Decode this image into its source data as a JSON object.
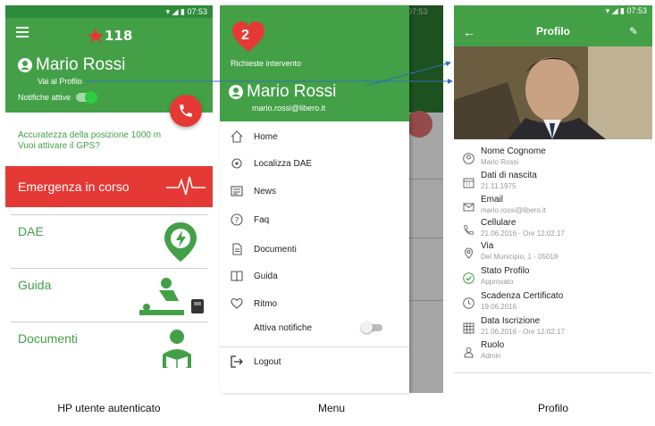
{
  "status_time": "07:53",
  "colors": {
    "primary": "#43a047",
    "emergency": "#e53935",
    "divider": "#cccccc"
  },
  "home": {
    "user_name": "Mario Rossi",
    "profile_link": "Vai al Profilo",
    "notifications_label": "Notifiche attive",
    "gps_line1": "Accuratezza della posizione 1000 m",
    "gps_line2": "Vuoi attivare il GPS?",
    "emergency_label": "Emergenza in corso",
    "tiles": [
      {
        "label": "DAE",
        "icon": "dae-location-icon"
      },
      {
        "label": "Guida",
        "icon": "cpr-guide-icon"
      },
      {
        "label": "Documenti",
        "icon": "reading-person-icon"
      }
    ]
  },
  "menu": {
    "badge_count": "2",
    "requests_label": "Richieste intervento",
    "user_name": "Mario Rossi",
    "email": "mario.rossi@libero.it",
    "items": [
      {
        "label": "Home",
        "icon": "home-icon"
      },
      {
        "label": "Localizza DAE",
        "icon": "locate-icon"
      },
      {
        "label": "News",
        "icon": "news-icon"
      },
      {
        "label": "Faq",
        "icon": "help-icon"
      },
      {
        "label": "Documenti",
        "icon": "document-icon"
      },
      {
        "label": "Guida",
        "icon": "book-icon"
      },
      {
        "label": "Ritmo",
        "icon": "heart-outline-icon"
      }
    ],
    "notifications_label": "Attiva notifiche",
    "logout_label": "Logout"
  },
  "profile": {
    "title": "Profilo",
    "fields": [
      {
        "label": "Nome Cognome",
        "value": "Mario Rossi",
        "icon": "user-circle-icon"
      },
      {
        "label": "Dati di nascita",
        "value": "21.11.1975",
        "icon": "calendar-icon"
      },
      {
        "label": "Email",
        "value": "mario.rossi@libero.it",
        "icon": "mail-icon"
      },
      {
        "label": "Cellulare",
        "value": "21.06.2016 - Ore 12:02:17",
        "icon": "phone-icon"
      },
      {
        "label": "Via",
        "value": "Del Municipio, 1 - 05018",
        "icon": "location-icon"
      },
      {
        "label": "Stato Profilo",
        "value": "Approvato",
        "icon": "check-circle-icon"
      },
      {
        "label": "Scadenza Certificato",
        "value": "19.06.2016",
        "icon": "clock-icon"
      },
      {
        "label": "Data Iscrizione",
        "value": "21.06.2016 - Ore 12:02:17",
        "icon": "calendar-grid-icon"
      },
      {
        "label": "Ruolo",
        "value": "Admin",
        "icon": "person-icon"
      }
    ]
  },
  "captions": {
    "home": "HP utente autenticato",
    "menu": "Menu",
    "profile": "Profilo"
  }
}
